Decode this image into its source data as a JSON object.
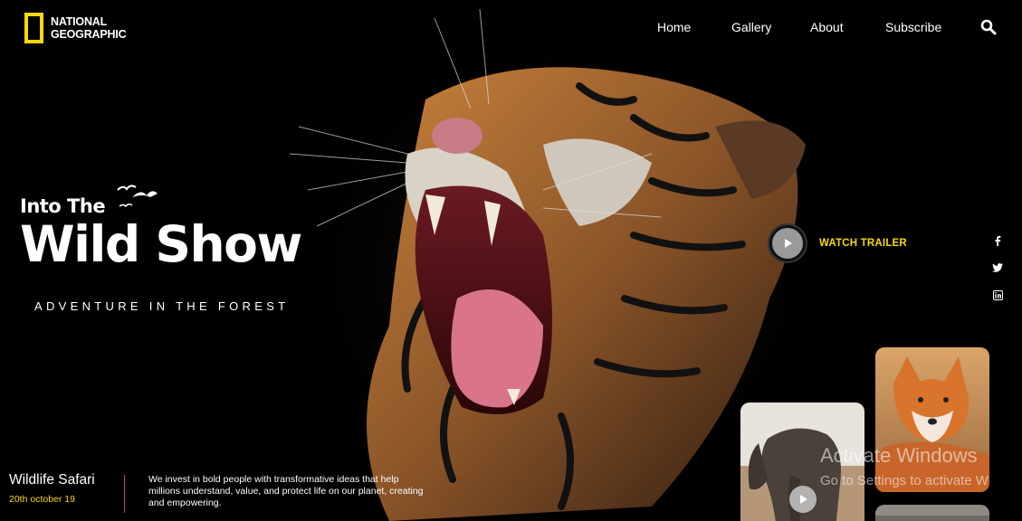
{
  "brand": {
    "line1": "NATIONAL",
    "line2": "GEOGRAPHIC",
    "accent": "#f5d90c"
  },
  "nav": {
    "items": [
      {
        "label": "Home"
      },
      {
        "label": "Gallery"
      },
      {
        "label": "About"
      },
      {
        "label": "Subscribe"
      }
    ],
    "search_icon": "search-icon"
  },
  "hero": {
    "pre_title": "Into The",
    "title": "Wild Show",
    "subtitle": "ADVENTURE IN THE FOREST",
    "image": "roaring-tiger"
  },
  "trailer": {
    "label": "WATCH TRAILER",
    "icon": "play-icon"
  },
  "social": [
    {
      "icon": "facebook-icon"
    },
    {
      "icon": "twitter-icon"
    },
    {
      "icon": "linkedin-icon"
    }
  ],
  "cards": [
    {
      "image": "elephant",
      "icon": "play-icon"
    },
    {
      "image": "fox"
    },
    {
      "image": "animal-thumbnail"
    }
  ],
  "footer": {
    "title": "Wildlife Safari",
    "date": "20th october 19",
    "description": "We invest in bold people with transformative ideas that help millions understand, value, and protect life on our planet, creating and empowering."
  },
  "watermark": {
    "title": "Activate Windows",
    "subtitle": "Go to Settings to activate W"
  }
}
